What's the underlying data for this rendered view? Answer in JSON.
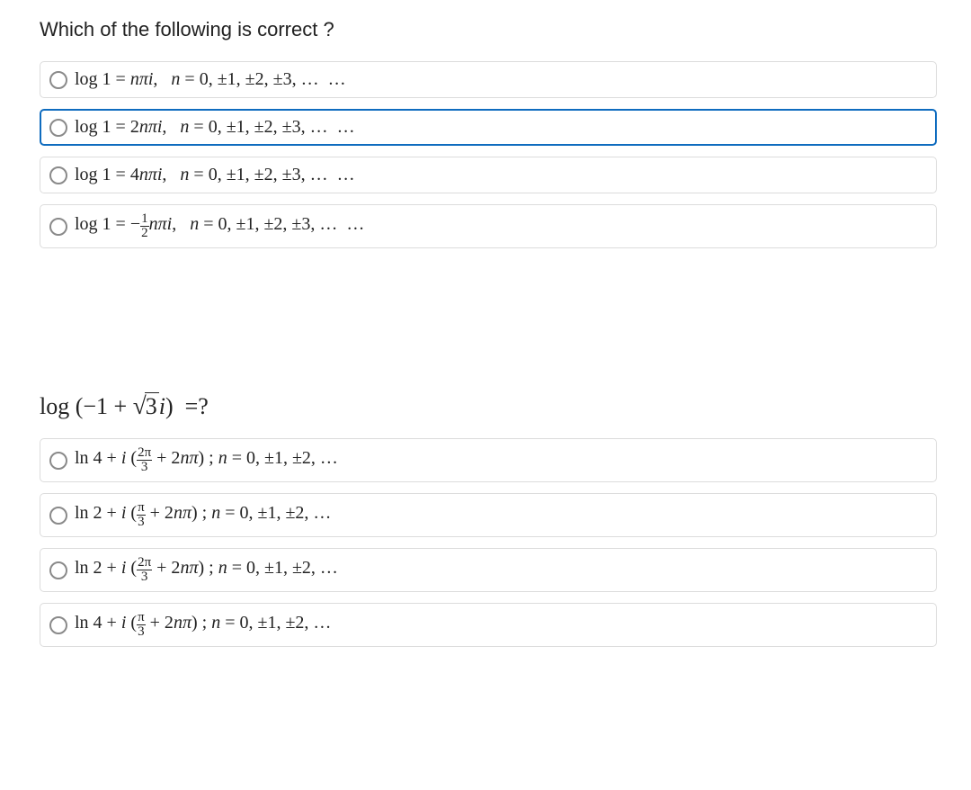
{
  "question1": {
    "prompt": "Which of the following is correct ?",
    "options": [
      {
        "html": "log 1 = <i>nπi</i>, &nbsp; <i>n</i> = 0, ±1, ±2, ±3, …&nbsp;&nbsp;…",
        "focused": false
      },
      {
        "html": "log 1 = 2<i>nπi</i>, &nbsp; <i>n</i> = 0, ±1, ±2, ±3, …&nbsp;&nbsp;…",
        "focused": true
      },
      {
        "html": "log 1 = 4<i>nπi</i>, &nbsp; <i>n</i> = 0, ±1, ±2, ±3, …&nbsp;&nbsp;…",
        "focused": false
      },
      {
        "html": "log 1 = −<span class=\"frac\"><span class=\"num\">1</span><span class=\"den\">2</span></span><i>nπi</i>, &nbsp; <i>n</i> = 0, ±1, ±2, ±3, …&nbsp;&nbsp;…",
        "focused": false
      }
    ]
  },
  "question2": {
    "prompt_html": "log (−1 + <span class=\"sqrt\"><span class=\"radical\">√</span><span class=\"radicand\">3</span></span><i>i</i>) &nbsp;=?",
    "options": [
      {
        "html": "ln 4 + <i>i</i> (<span class=\"frac\"><span class=\"num\">2π</span><span class=\"den\">3</span></span> + 2<i>nπ</i>) ; <i>n</i> = 0, ±1, ±2, …"
      },
      {
        "html": "ln 2 + <i>i</i> (<span class=\"frac\"><span class=\"num\">π</span><span class=\"den\">3</span></span> + 2<i>nπ</i>) ; <i>n</i> = 0, ±1, ±2, …"
      },
      {
        "html": "ln 2 + <i>i</i> (<span class=\"frac\"><span class=\"num\">2π</span><span class=\"den\">3</span></span> + 2<i>nπ</i>) ; <i>n</i> = 0, ±1, ±2, …"
      },
      {
        "html": "ln 4 + <i>i</i> (<span class=\"frac\"><span class=\"num\">π</span><span class=\"den\">3</span></span> + 2<i>nπ</i>) ; <i>n</i> = 0, ±1, ±2, …"
      }
    ]
  }
}
